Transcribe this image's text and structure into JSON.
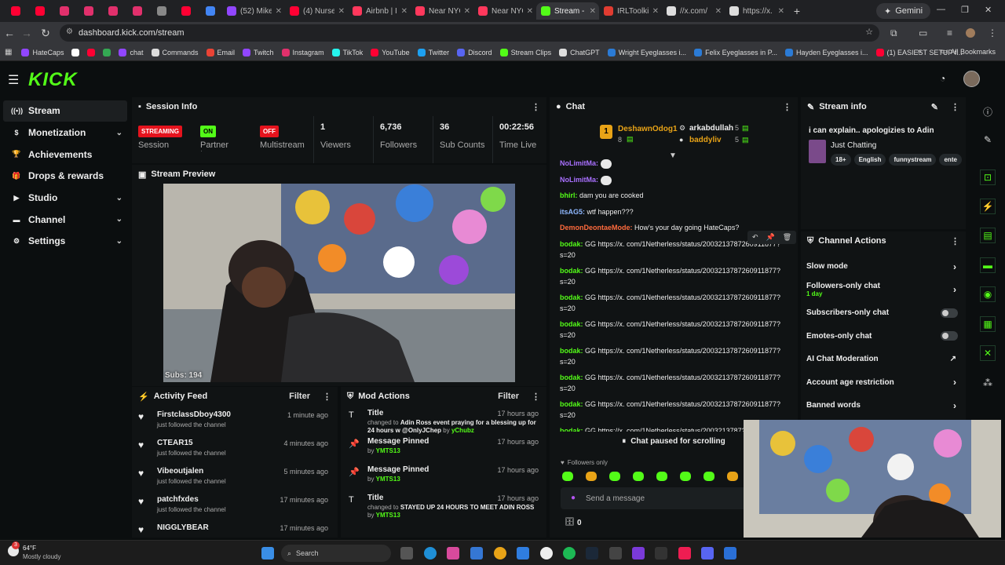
{
  "browser": {
    "tabs": [
      {
        "title": "",
        "color": "#ff0033"
      },
      {
        "title": "",
        "color": "#ff0033"
      },
      {
        "title": "",
        "color": "#e1306c"
      },
      {
        "title": "",
        "color": "#e1306c"
      },
      {
        "title": "",
        "color": "#e1306c"
      },
      {
        "title": "",
        "color": "#e1306c"
      },
      {
        "title": "",
        "color": "#888888"
      },
      {
        "title": "",
        "color": "#ff0033"
      },
      {
        "title": "",
        "color": "#4285f4"
      },
      {
        "title": "(52) Mike",
        "color": "#9146ff"
      },
      {
        "title": "(4) Nurse",
        "color": "#ff0033"
      },
      {
        "title": "Airbnb | I",
        "color": "#ff385c"
      },
      {
        "title": "Near NYC",
        "color": "#ff385c"
      },
      {
        "title": "Near NYC",
        "color": "#ff385c"
      },
      {
        "title": "Stream - I",
        "color": "#53fc18",
        "active": true
      },
      {
        "title": "IRLToolkit",
        "color": "#e03c31"
      },
      {
        "title": "//x.com/",
        "color": "#dddddd"
      },
      {
        "title": "https://x.",
        "color": "#dddddd"
      }
    ],
    "gemini_label": "Gemini",
    "url": "dashboard.kick.com/stream",
    "bookmarks": [
      {
        "label": "HateCaps",
        "color": "#9146ff"
      },
      {
        "label": "",
        "color": "#ffffff"
      },
      {
        "label": "",
        "color": "#ff0033"
      },
      {
        "label": "",
        "color": "#34a853"
      },
      {
        "label": "chat",
        "color": "#9146ff"
      },
      {
        "label": "Commands",
        "color": "#dddddd"
      },
      {
        "label": "Email",
        "color": "#ea4335"
      },
      {
        "label": "Twitch",
        "color": "#9146ff"
      },
      {
        "label": "Instagram",
        "color": "#e1306c"
      },
      {
        "label": "TikTok",
        "color": "#25f4ee"
      },
      {
        "label": "YouTube",
        "color": "#ff0033"
      },
      {
        "label": "Twitter",
        "color": "#1da1f2"
      },
      {
        "label": "Discord",
        "color": "#5865f2"
      },
      {
        "label": "Stream Clips",
        "color": "#53fc18"
      },
      {
        "label": "ChatGPT",
        "color": "#dddddd"
      },
      {
        "label": "Wright Eyeglasses i...",
        "color": "#2b7bd6"
      },
      {
        "label": "Felix Eyeglasses in P...",
        "color": "#2b7bd6"
      },
      {
        "label": "Hayden Eyeglasses i...",
        "color": "#2b7bd6"
      },
      {
        "label": "(1) EASIEST SETUP f...",
        "color": "#ff0033"
      }
    ],
    "all_bookmarks": "All Bookmarks"
  },
  "kick": {
    "logo": "KICK",
    "sidebar": [
      {
        "label": "Stream",
        "icon": "broadcast-icon",
        "glyph": "((•))",
        "selected": true,
        "chevron": false
      },
      {
        "label": "Monetization",
        "icon": "dollar-icon",
        "glyph": "$",
        "chevron": true
      },
      {
        "label": "Achievements",
        "icon": "trophy-icon",
        "glyph": "🏆",
        "chevron": false
      },
      {
        "label": "Drops & rewards",
        "icon": "gift-icon",
        "glyph": "🎁",
        "chevron": false
      },
      {
        "label": "Studio",
        "icon": "studio-icon",
        "glyph": "▶",
        "chevron": true
      },
      {
        "label": "Channel",
        "icon": "channel-icon",
        "glyph": "▬",
        "chevron": true
      },
      {
        "label": "Settings",
        "icon": "gear-icon",
        "glyph": "⚙",
        "chevron": true
      }
    ]
  },
  "session": {
    "title": "Session Info",
    "streaming_badge": "STREAMING",
    "session_label": "Session",
    "on_badge": "ON",
    "partner_label": "Partner Income",
    "off_badge": "OFF",
    "multistream_label": "Multistream",
    "viewers": "1",
    "viewers_label": "Viewers",
    "followers": "6,736",
    "followers_label": "Followers",
    "subs": "36",
    "subs_label": "Sub Counts",
    "time": "00:22:56",
    "time_label": "Time Live"
  },
  "preview": {
    "title": "Stream Preview",
    "subs_overlay": "Subs: 194"
  },
  "activity": {
    "title": "Activity Feed",
    "filter": "Filter",
    "items": [
      {
        "name": "FirstclassDboy4300",
        "sub": "just followed the channel",
        "time": "1 minute ago"
      },
      {
        "name": "CTEAR15",
        "sub": "just followed the channel",
        "time": "4 minutes ago"
      },
      {
        "name": "Vibeoutjalen",
        "sub": "just followed the channel",
        "time": "5 minutes ago"
      },
      {
        "name": "patchfxdes",
        "sub": "just followed the channel",
        "time": "17 minutes ago"
      },
      {
        "name": "NIGGLYBEAR",
        "sub": "",
        "time": "17 minutes ago"
      }
    ]
  },
  "mod": {
    "title": "Mod Actions",
    "filter": "Filter",
    "items": [
      {
        "icon": "title-icon",
        "glyph": "T",
        "name": "Title",
        "pre": "changed to ",
        "bold": "Adin Ross event praying for a blessing up for 24 hours w @OnlyJChep",
        "by": " by ",
        "user": "yChubz",
        "time": "17 hours ago"
      },
      {
        "icon": "pin-icon",
        "glyph": "📌",
        "name": "Message Pinned",
        "pre": "",
        "bold": "",
        "by": "by ",
        "user": "YMTS13",
        "time": "17 hours ago"
      },
      {
        "icon": "pin-icon",
        "glyph": "📌",
        "name": "Message Pinned",
        "pre": "",
        "bold": "",
        "by": "by ",
        "user": "YMTS13",
        "time": "17 hours ago"
      },
      {
        "icon": "title-icon",
        "glyph": "T",
        "name": "Title",
        "pre": "changed to ",
        "bold": "STAYED UP 24 HOURS TO MEET ADIN ROSS",
        "by": " by ",
        "user": "YMTS13",
        "time": "17 hours ago"
      }
    ]
  },
  "chat": {
    "title": "Chat",
    "top_gifter": {
      "name": "DeshawnOdog1",
      "count": "8"
    },
    "gifters": [
      {
        "name": "arkabdullah",
        "count": "5"
      },
      {
        "name": "baddyliv",
        "count": "5"
      }
    ],
    "messages": [
      {
        "user": "NoLimitMa:",
        "text": "",
        "color": "#a970ff"
      },
      {
        "user": "NoLimitMa:",
        "text": "",
        "color": "#a970ff"
      },
      {
        "user": "bhirl:",
        "text": "dam you are cooked",
        "color": "#53fc18"
      },
      {
        "user": "itsAG5:",
        "text": "wtf happen???",
        "color": "#8fb8ff"
      },
      {
        "user": "DemonDeontaeMode:",
        "text": "How's your day going HateCaps?",
        "color": "#ff6b3d"
      },
      {
        "user": "bodak:",
        "text": "GG https://x. com/1Netherless/status/2003213787260911877?s=20",
        "color": "#53fc18"
      },
      {
        "user": "bodak:",
        "text": "GG https://x. com/1Netherless/status/2003213787260911877?s=20",
        "color": "#53fc18"
      },
      {
        "user": "bodak:",
        "text": "GG https://x. com/1Netherless/status/2003213787260911877?s=20",
        "color": "#53fc18"
      },
      {
        "user": "bodak:",
        "text": "GG https://x. com/1Netherless/status/2003213787260911877?s=20",
        "color": "#53fc18"
      },
      {
        "user": "bodak:",
        "text": "GG https://x. com/1Netherless/status/2003213787260911877?s=20",
        "color": "#53fc18"
      },
      {
        "user": "bodak:",
        "text": "GG https://x. com/1Netherless/status/2003213787260911877?s=20",
        "color": "#53fc18"
      },
      {
        "user": "bodak:",
        "text": "GG https://x. com/1Netherless/status/2003213787260911877?s=20",
        "color": "#53fc18"
      },
      {
        "user": "bodak:",
        "text": "GG https://x. com/1Netherless/status/2003213787260911877?s=20",
        "color": "#53fc18"
      }
    ],
    "paused": "Chat paused for scrolling",
    "followers_only": "Followers only",
    "placeholder": "Send a message",
    "count": "0"
  },
  "stream_info": {
    "title": "Stream info",
    "stream_title": "i can explain.. apologizies to Adin",
    "category": "Just Chatting",
    "tags": [
      "18+",
      "English",
      "funnystream",
      "ente"
    ]
  },
  "channel_actions": {
    "title": "Channel Actions",
    "items": [
      {
        "label": "Slow mode",
        "sub": "",
        "control": "arrow"
      },
      {
        "label": "Followers-only chat",
        "sub": "1 day",
        "control": "arrow"
      },
      {
        "label": "Subscribers-only chat",
        "sub": "",
        "control": "toggle"
      },
      {
        "label": "Emotes-only chat",
        "sub": "",
        "control": "toggle"
      },
      {
        "label": "AI Chat Moderation",
        "sub": "",
        "control": "external"
      },
      {
        "label": "Account age restriction",
        "sub": "",
        "control": "arrow"
      },
      {
        "label": "Banned words",
        "sub": "",
        "control": "arrow"
      }
    ]
  },
  "taskbar": {
    "weather_temp": "64°F",
    "weather_desc": "Mostly cloudy",
    "notif_count": "3",
    "search": "Search"
  },
  "colors": {
    "accent": "#53fc18",
    "danger": "#e5131d"
  }
}
